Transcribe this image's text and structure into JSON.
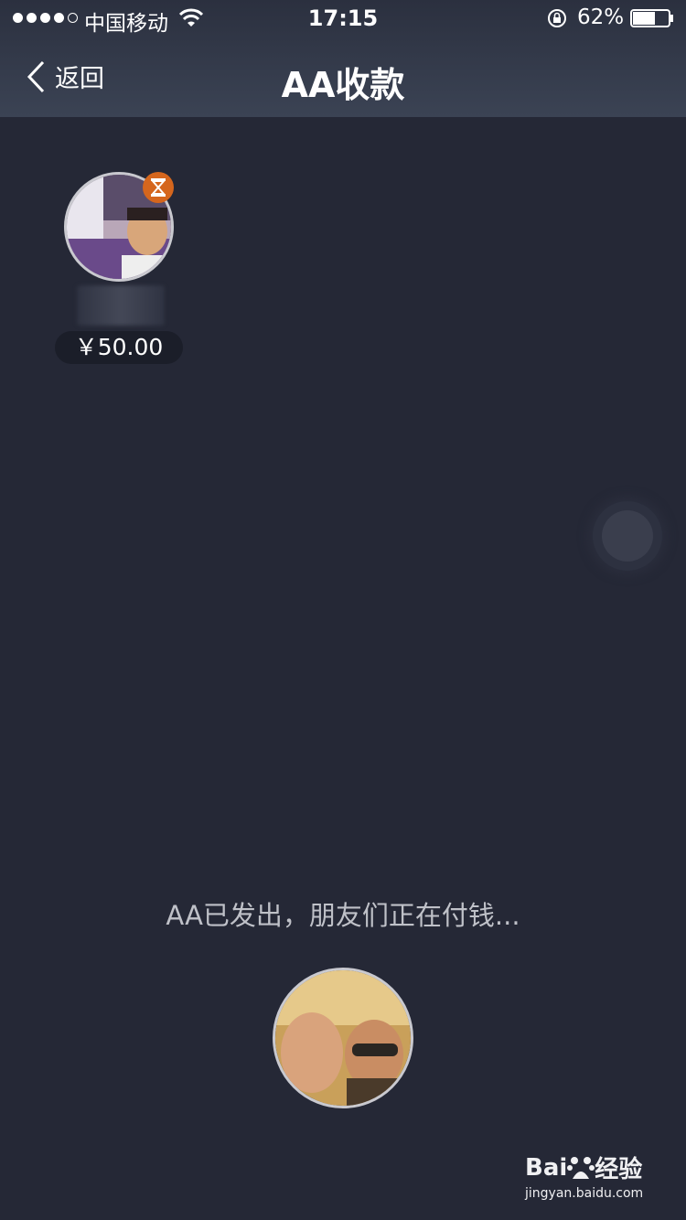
{
  "status_bar": {
    "carrier": "中国移动",
    "time": "17:15",
    "battery_percent": "62%",
    "battery_level": 0.62,
    "signal_bars_filled": 4,
    "signal_bars_total": 5
  },
  "nav": {
    "back_label": "返回",
    "title": "AA收款"
  },
  "member": {
    "amount": "￥50.00",
    "badge_icon": "hourglass-icon"
  },
  "main": {
    "status_text": "AA已发出，朋友们正在付钱..."
  },
  "watermark": {
    "brand": "Bai",
    "brand_suffix": "经验",
    "url": "jingyan.baidu.com"
  },
  "colors": {
    "background": "#252836",
    "header": "#3b4354",
    "badge": "#d5661d"
  }
}
